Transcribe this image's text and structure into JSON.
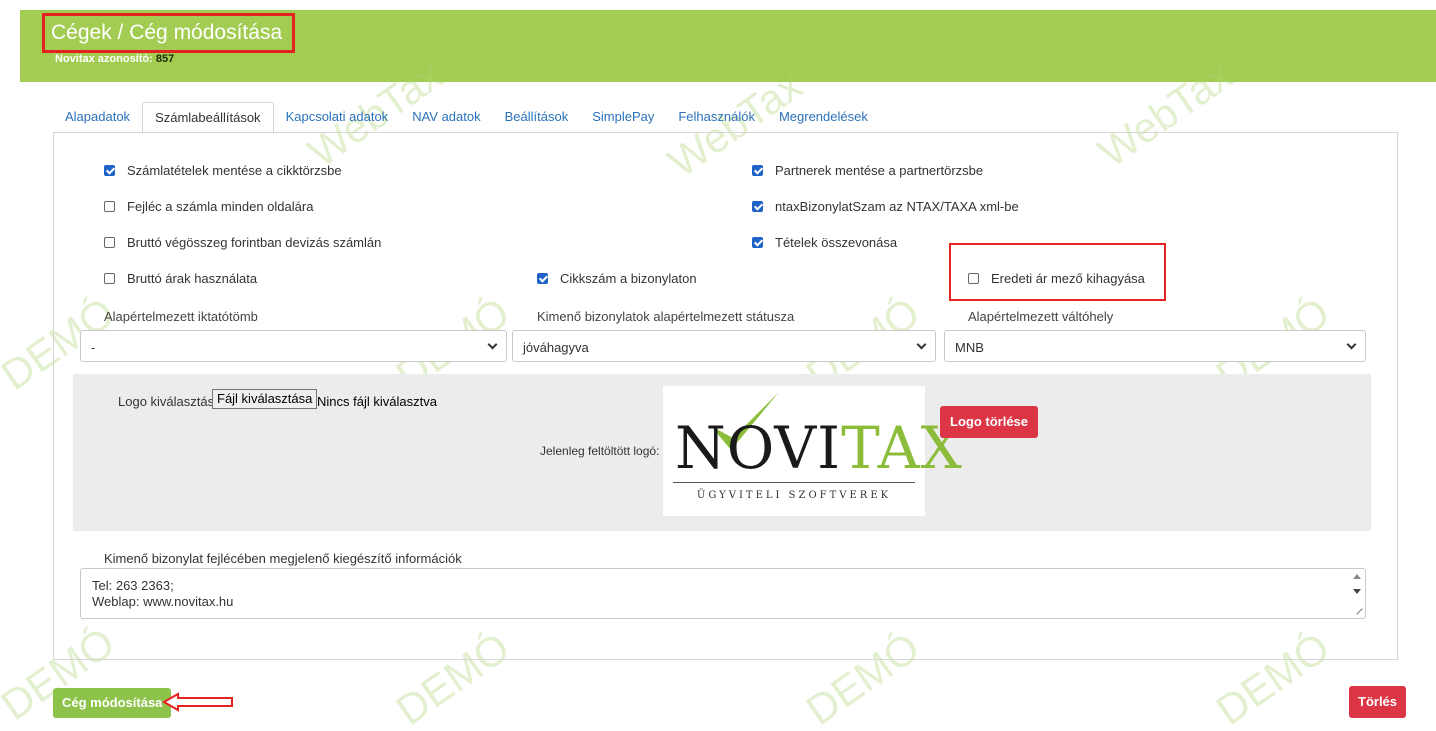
{
  "header": {
    "title": "Cégek / Cég módosítása",
    "id_label": "Novitax azonosító:",
    "id_value": "857",
    "bg_color": "#a3cd52"
  },
  "watermarks": {
    "webtax": "WebTax",
    "demo": "DEMÓ"
  },
  "tabs": [
    {
      "label": "Alapadatok",
      "active": false
    },
    {
      "label": "Számlabeállítások",
      "active": true
    },
    {
      "label": "Kapcsolati adatok",
      "active": false
    },
    {
      "label": "NAV adatok",
      "active": false
    },
    {
      "label": "Beállítások",
      "active": false
    },
    {
      "label": "SimplePay",
      "active": false
    },
    {
      "label": "Felhasználók",
      "active": false
    },
    {
      "label": "Megrendelések",
      "active": false
    }
  ],
  "checkboxes": {
    "save_items": {
      "label": "Számlatételek mentése a cikktörzsbe",
      "checked": true
    },
    "header_every_page": {
      "label": "Fejléc a számla minden oldalára",
      "checked": false
    },
    "gross_total_huf": {
      "label": "Bruttó végösszeg forintban devizás számlán",
      "checked": false
    },
    "gross_prices": {
      "label": "Bruttó árak használata",
      "checked": false
    },
    "save_partners": {
      "label": "Partnerek mentése a partnertörzsbe",
      "checked": true
    },
    "ntax_number": {
      "label": "ntaxBizonylatSzam az NTAX/TAXA xml-be",
      "checked": true
    },
    "merge_items": {
      "label": "Tételek összevonása",
      "checked": true
    },
    "item_code": {
      "label": "Cikkszám a bizonylaton",
      "checked": true
    },
    "skip_original_price": {
      "label": "Eredeti ár mező kihagyása",
      "checked": false
    }
  },
  "selects": {
    "register": {
      "label": "Alapértelmezett iktatótömb",
      "value": "-"
    },
    "status": {
      "label": "Kimenő bizonylatok alapértelmezett státusza",
      "value": "jóváhagyva"
    },
    "exchange": {
      "label": "Alapértelmezett váltóhely",
      "value": "MNB"
    }
  },
  "logo": {
    "select_label": "Logo kiválasztása:",
    "file_button": "Fájl kiválasztása",
    "no_file": "Nincs fájl kiválasztva",
    "current_label": "Jelenleg feltöltött logó:",
    "logo_text_nov": "NOVI",
    "logo_text_tax": "TAX",
    "logo_tagline": "ÜGYVITELI SZOFTVEREK",
    "delete_button": "Logo törlése",
    "brand_green": "#8cbd3a"
  },
  "extra_info": {
    "label": "Kimenő bizonylat fejlécében megjelenő kiegészítő információk",
    "line1": "Tel: 263 2363;",
    "line2": "Weblap: www.novitax.hu"
  },
  "footer": {
    "save_button": "Cég módosítása",
    "delete_button": "Törlés",
    "danger_color": "#dc3545",
    "highlight_color": "#e52222"
  }
}
